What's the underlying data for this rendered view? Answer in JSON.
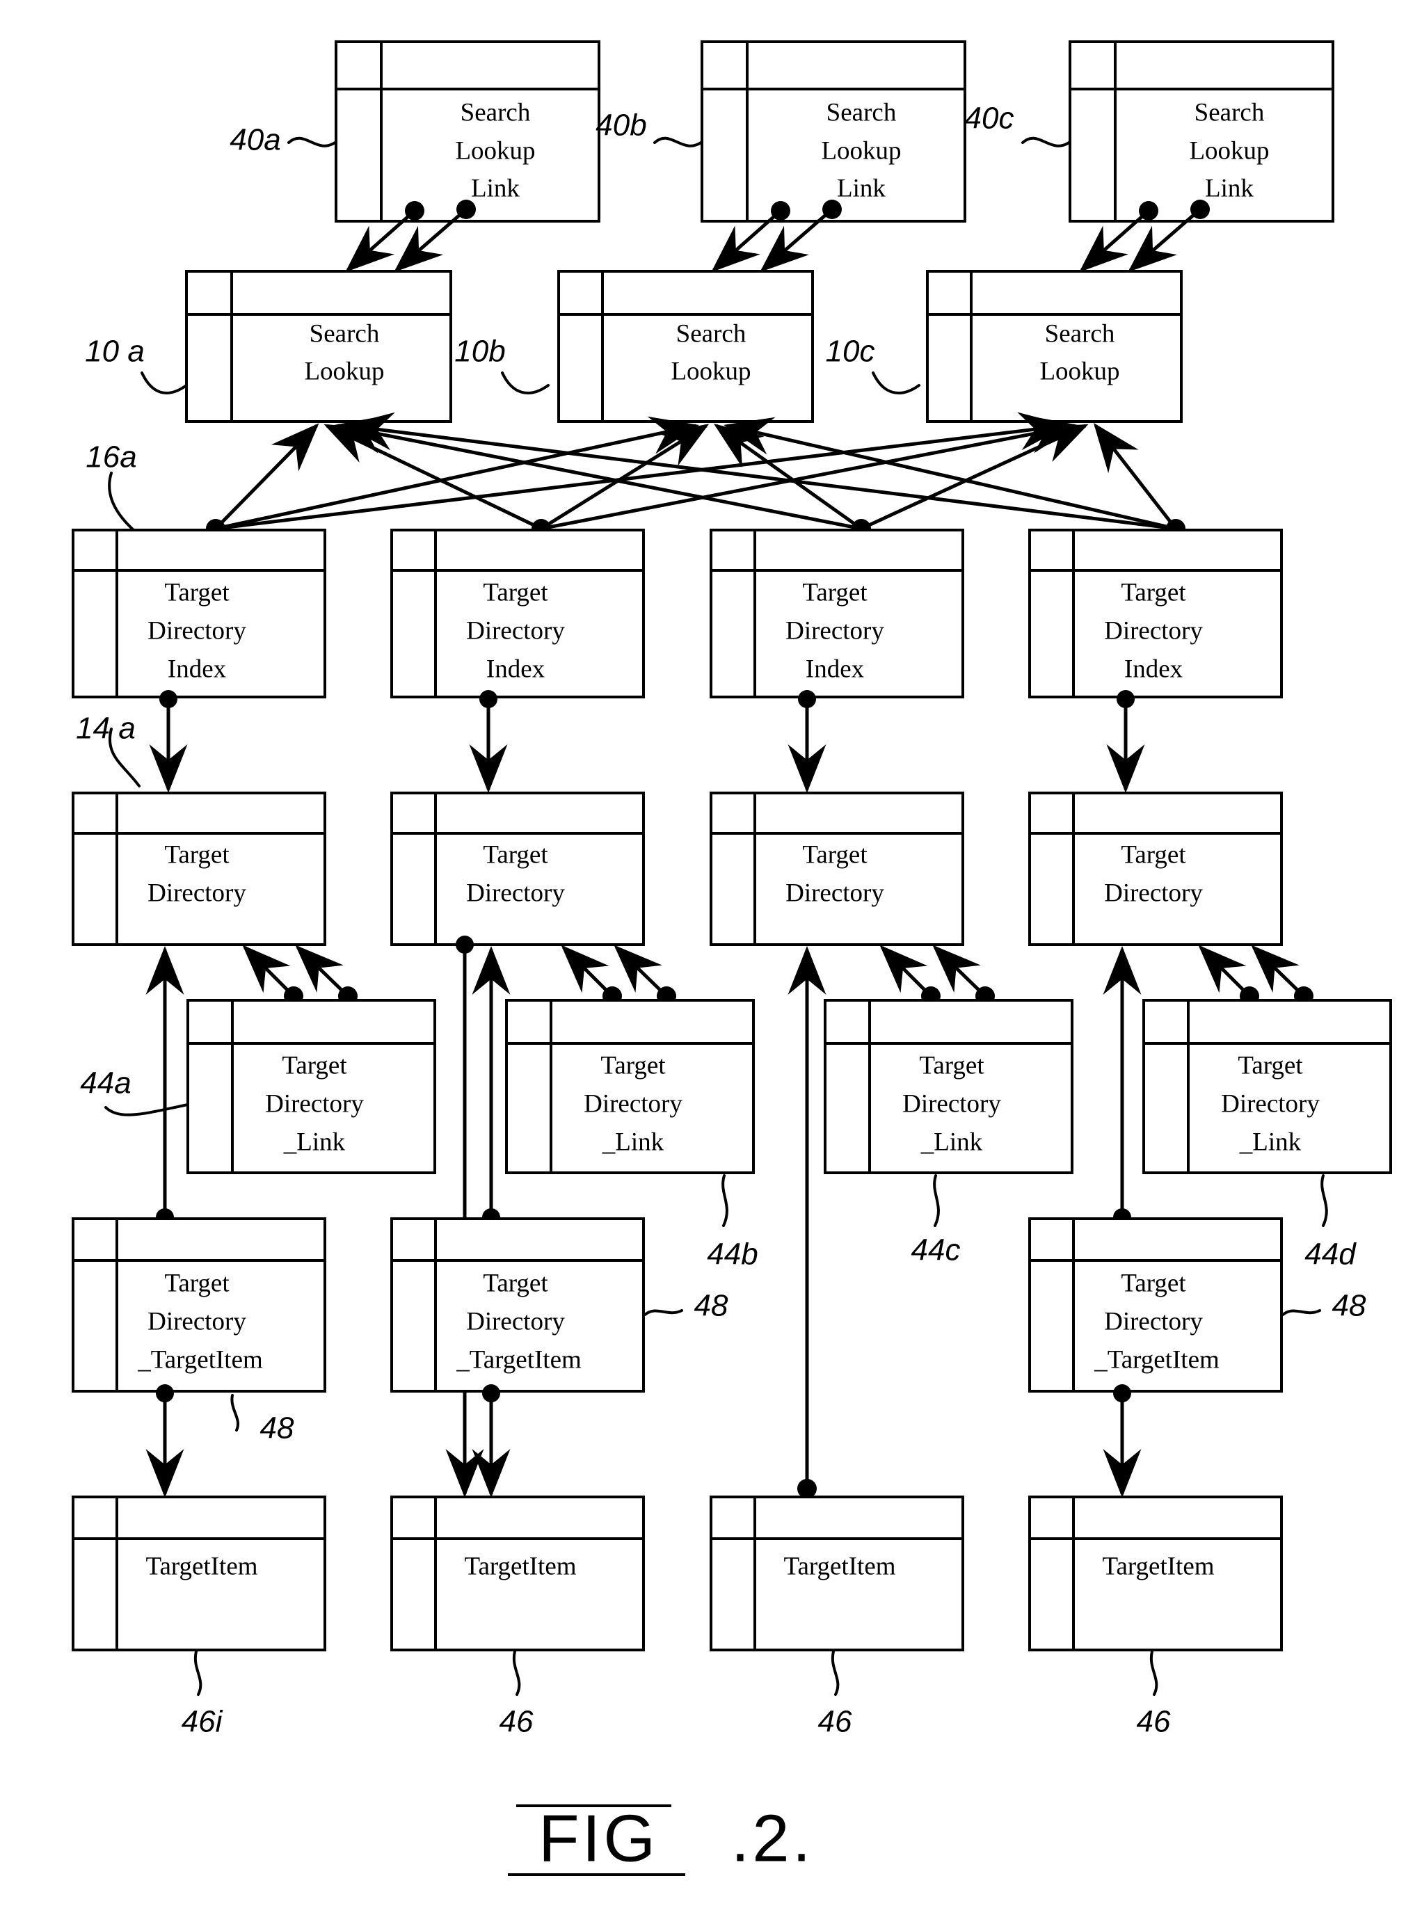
{
  "figure": {
    "caption": "FIG.2.",
    "caption_main": "FIG",
    "caption_tail": ".2."
  },
  "rows": [
    {
      "id": "search-lookup-link",
      "label": "Search\nLookup\nLink",
      "line1": "Search",
      "line2": "Lookup",
      "line3": "Link",
      "refs": [
        "40a",
        "40b",
        "40c"
      ]
    },
    {
      "id": "search-lookup",
      "label": "Search\nLookup",
      "line1": "Search",
      "line2": "Lookup",
      "refs": [
        "10 a",
        "10b",
        "10c"
      ]
    },
    {
      "id": "target-directory-index",
      "label": "Target\nDirectory\nIndex",
      "line1": "Target",
      "line2": "Directory",
      "line3": "Index",
      "refs": [
        "16a"
      ]
    },
    {
      "id": "target-directory",
      "label": "Target\nDirectory",
      "line1": "Target",
      "line2": "Directory",
      "refs": [
        "14 a"
      ]
    },
    {
      "id": "target-directory-link",
      "label": "Target\nDirectory\n_Link",
      "line1": "Target",
      "line2": "Directory",
      "line3": "_Link",
      "refs": [
        "44a",
        "44b",
        "44c",
        "44d"
      ]
    },
    {
      "id": "target-directory-targetitem",
      "label": "Target\nDirectory\n_TargetItem",
      "line1": "Target",
      "line2": "Directory",
      "line3": "_TargetItem",
      "refs": [
        "48",
        "48",
        "48"
      ]
    },
    {
      "id": "targetitem",
      "label": "TargetItem",
      "line1": "TargetItem",
      "refs": [
        "46i",
        "46",
        "46",
        "46"
      ]
    }
  ],
  "boxes": {
    "sll_a": {
      "l1": "Search",
      "l2": "Lookup",
      "l3": "Link"
    },
    "sll_b": {
      "l1": "Search",
      "l2": "Lookup",
      "l3": "Link"
    },
    "sll_c": {
      "l1": "Search",
      "l2": "Lookup",
      "l3": "Link"
    },
    "sl_a": {
      "l1": "Search",
      "l2": "Lookup"
    },
    "sl_b": {
      "l1": "Search",
      "l2": "Lookup"
    },
    "sl_c": {
      "l1": "Search",
      "l2": "Lookup"
    },
    "tdi_1": {
      "l1": "Target",
      "l2": "Directory",
      "l3": "Index"
    },
    "tdi_2": {
      "l1": "Target",
      "l2": "Directory",
      "l3": "Index"
    },
    "tdi_3": {
      "l1": "Target",
      "l2": "Directory",
      "l3": "Index"
    },
    "tdi_4": {
      "l1": "Target",
      "l2": "Directory",
      "l3": "Index"
    },
    "td_1": {
      "l1": "Target",
      "l2": "Directory"
    },
    "td_2": {
      "l1": "Target",
      "l2": "Directory"
    },
    "td_3": {
      "l1": "Target",
      "l2": "Directory"
    },
    "td_4": {
      "l1": "Target",
      "l2": "Directory"
    },
    "tdl_1": {
      "l1": "Target",
      "l2": "Directory",
      "l3": "_Link"
    },
    "tdl_2": {
      "l1": "Target",
      "l2": "Directory",
      "l3": "_Link"
    },
    "tdl_3": {
      "l1": "Target",
      "l2": "Directory",
      "l3": "_Link"
    },
    "tdl_4": {
      "l1": "Target",
      "l2": "Directory",
      "l3": "_Link"
    },
    "tdti_1": {
      "l1": "Target",
      "l2": "Directory",
      "l3": "_TargetItem"
    },
    "tdti_2": {
      "l1": "Target",
      "l2": "Directory",
      "l3": "_TargetItem"
    },
    "tdti_4": {
      "l1": "Target",
      "l2": "Directory",
      "l3": "_TargetItem"
    },
    "ti_1": {
      "l1": "TargetItem"
    },
    "ti_2": {
      "l1": "TargetItem"
    },
    "ti_3": {
      "l1": "TargetItem"
    },
    "ti_4": {
      "l1": "TargetItem"
    }
  },
  "ref_labels": {
    "r40a": "40a",
    "r40b": "40b",
    "r40c": "40c",
    "r10a": "10 a",
    "r10b": "10b",
    "r10c": "10c",
    "r16a": "16a",
    "r14a": "14 a",
    "r44a": "44a",
    "r44b": "44b",
    "r44c": "44c",
    "r44d": "44d",
    "r48_1": "48",
    "r48_2": "48",
    "r48_4": "48",
    "r46i": "46i",
    "r46_2": "46",
    "r46_3": "46",
    "r46_4": "46"
  },
  "colors": {
    "ink": "#000000",
    "paper": "#ffffff"
  }
}
